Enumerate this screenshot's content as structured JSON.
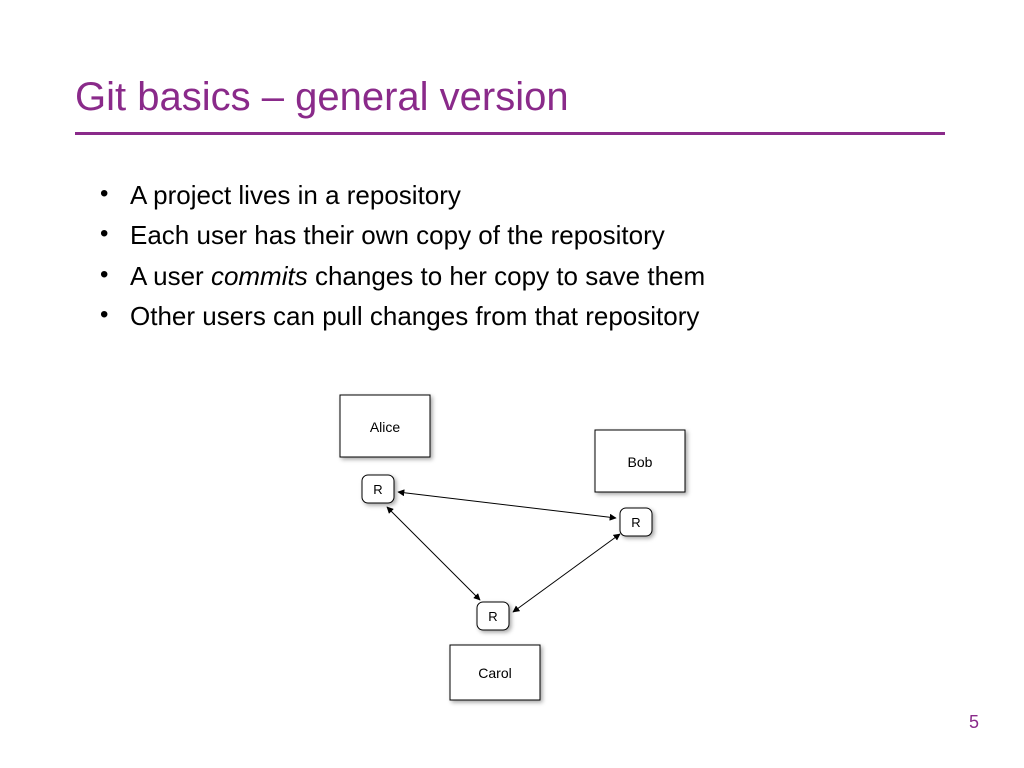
{
  "title": "Git basics – general version",
  "bullets": [
    {
      "pre": "A project lives in a repository",
      "em": "",
      "post": ""
    },
    {
      "pre": "Each user has their own copy of the repository",
      "em": "",
      "post": ""
    },
    {
      "pre": "A user ",
      "em": "commits",
      "post": " changes to her copy to save them"
    },
    {
      "pre": "Other users can pull changes from that repository",
      "em": "",
      "post": ""
    }
  ],
  "diagram": {
    "users": [
      "Alice",
      "Bob",
      "Carol"
    ],
    "repo_label": "R"
  },
  "page_number": "5",
  "colors": {
    "accent": "#8a2a8a"
  }
}
